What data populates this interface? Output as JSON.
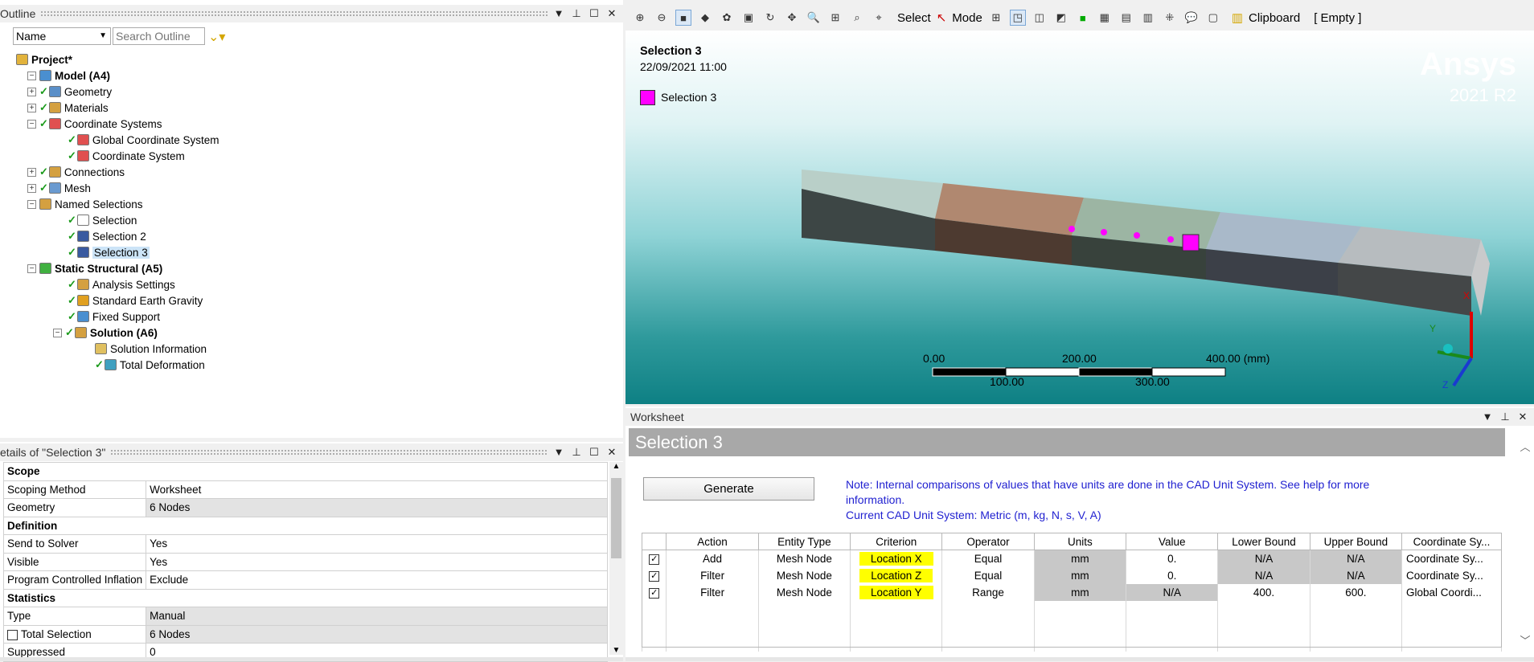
{
  "outline": {
    "title": "Outline",
    "filter_field": "Name",
    "search_placeholder": "Search Outline",
    "items": [
      {
        "label": "Project*",
        "bold": true
      },
      {
        "label": "Model (A4)",
        "bold": true
      },
      {
        "label": "Geometry"
      },
      {
        "label": "Materials"
      },
      {
        "label": "Coordinate Systems"
      },
      {
        "label": "Global Coordinate System"
      },
      {
        "label": "Coordinate System"
      },
      {
        "label": "Connections"
      },
      {
        "label": "Mesh"
      },
      {
        "label": "Named Selections"
      },
      {
        "label": "Selection"
      },
      {
        "label": "Selection 2"
      },
      {
        "label": "Selection 3"
      },
      {
        "label": "Static Structural (A5)",
        "bold": true
      },
      {
        "label": "Analysis Settings"
      },
      {
        "label": "Standard Earth Gravity"
      },
      {
        "label": "Fixed Support"
      },
      {
        "label": "Solution (A6)",
        "bold": true
      },
      {
        "label": "Solution Information"
      },
      {
        "label": "Total Deformation"
      }
    ]
  },
  "details": {
    "title": "etails of \"Selection 3\"",
    "rows": [
      {
        "group": "Scope"
      },
      {
        "k": "Scoping Method",
        "v": "Worksheet"
      },
      {
        "k": "Geometry",
        "v": "6 Nodes",
        "gray": true
      },
      {
        "group": "Definition"
      },
      {
        "k": "Send to Solver",
        "v": "Yes"
      },
      {
        "k": "Visible",
        "v": "Yes"
      },
      {
        "k": "Program Controlled Inflation",
        "v": "Exclude"
      },
      {
        "group": "Statistics"
      },
      {
        "k": "Type",
        "v": "Manual",
        "gray": true
      },
      {
        "k": "Total Selection",
        "v": "6 Nodes",
        "gray": true
      },
      {
        "k": "Suppressed",
        "v": "0"
      }
    ]
  },
  "toolbar": {
    "select": "Select",
    "mode": "Mode",
    "clipboard": "Clipboard",
    "empty": "[ Empty ]"
  },
  "viewport": {
    "title": "Selection 3",
    "date": "22/09/2021 11:00",
    "legend": "Selection 3",
    "legend_color": "#ff00ff",
    "brand": "Ansys",
    "version": "2021 R2",
    "scale_top": [
      "0.00",
      "200.00",
      "400.00 (mm)"
    ],
    "scale_bottom": [
      "100.00",
      "300.00"
    ]
  },
  "worksheet": {
    "panel_title": "Worksheet",
    "title": "Selection 3",
    "generate": "Generate",
    "note1": "Note: Internal comparisons of values that have units are done in the CAD Unit System. See help for more information.",
    "note2": "Current CAD Unit System:  Metric (m, kg, N, s, V, A)",
    "headers": [
      "",
      "Action",
      "Entity Type",
      "Criterion",
      "Operator",
      "Units",
      "Value",
      "Lower Bound",
      "Upper Bound",
      "Coordinate Sy..."
    ],
    "rows": [
      {
        "action": "Add",
        "entity": "Mesh Node",
        "criterion": "Location X",
        "operator": "Equal",
        "units": "mm",
        "value": "0.",
        "lower": "N/A",
        "upper": "N/A",
        "coord": "Coordinate Sy..."
      },
      {
        "action": "Filter",
        "entity": "Mesh Node",
        "criterion": "Location Z",
        "operator": "Equal",
        "units": "mm",
        "value": "0.",
        "lower": "N/A",
        "upper": "N/A",
        "coord": "Coordinate Sy..."
      },
      {
        "action": "Filter",
        "entity": "Mesh Node",
        "criterion": "Location Y",
        "operator": "Range",
        "units": "mm",
        "value": "N/A",
        "lower": "400.",
        "upper": "600.",
        "coord": "Global Coordi..."
      }
    ]
  }
}
